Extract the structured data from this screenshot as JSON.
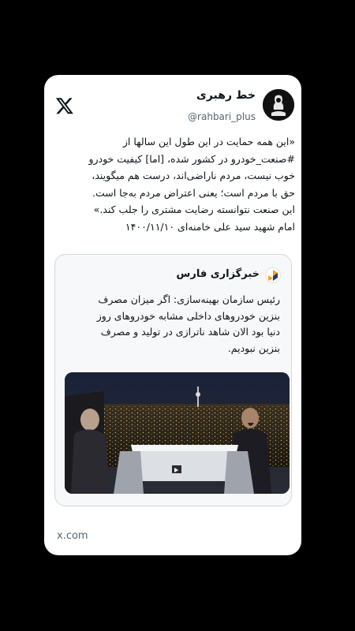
{
  "tweet": {
    "display_name": "خط رهبری",
    "handle": "@rahbari_plus",
    "text_lines": [
      "«این همه حمایت در این طول این سالها از",
      "#صنعت_خودرو در کشور شده، [اما] کیفیت خودرو",
      "خوب نیست، مردم ناراضی‌اند، درست هم میگویند،",
      "حق با مردم است؛ یعنی اعتراض مردم به‌جا است.",
      "این صنعت نتوانسته رضایت مشتری را جلب کند.»",
      "امام شهید سید علی خامنه‌ای ۱۴۰۰/۱۱/۱۰"
    ]
  },
  "quote": {
    "source_name": "خبرگزاری فارس",
    "text_lines": [
      "رئیس سازمان بهینه‌سازی: اگر میزان مصرف",
      "بنزین خودروهای داخلی مشابه خودروهای روز",
      "دنیا بود الان شاهد ناترازی در تولید و مصرف",
      "بنزین نبودیم."
    ]
  },
  "footer": {
    "source": "x.com"
  },
  "icons": {
    "platform": "x-logo-icon",
    "avatar": "avatar-image",
    "quote_avatar": "fars-news-logo-icon",
    "media": "tv-interview-image"
  },
  "colors": {
    "card": "#ffffff",
    "secondary_text": "#536471",
    "border": "#cfd9de",
    "background": "#000000"
  }
}
